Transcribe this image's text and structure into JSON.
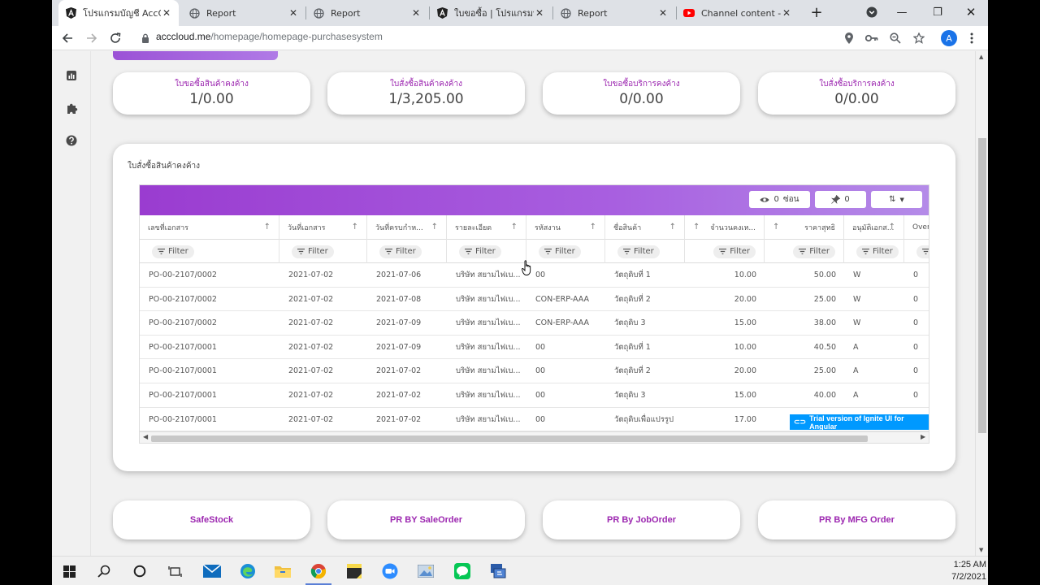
{
  "browser": {
    "tabs": [
      {
        "title": "โปรแกรมบัญชี AccClo",
        "icon": "angular-icon",
        "active": true
      },
      {
        "title": "Report",
        "icon": "globe-icon",
        "active": false
      },
      {
        "title": "Report",
        "icon": "globe-icon",
        "active": false
      },
      {
        "title": "ใบขอซื้อ | โปรแกรมบัญ",
        "icon": "angular-icon",
        "active": false
      },
      {
        "title": "Report",
        "icon": "globe-icon",
        "active": false
      },
      {
        "title": "Channel content - Y",
        "icon": "youtube-icon",
        "active": false
      }
    ],
    "url_host": "acccloud.me",
    "url_path": "/homepage/homepage-purchasesystem",
    "avatar_letter": "A"
  },
  "stats": [
    {
      "title": "ใบขอซื้อสินค้าคงค้าง",
      "value": "1/0.00"
    },
    {
      "title": "ใบสั่งซื้อสินค้าคงค้าง",
      "value": "1/3,205.00"
    },
    {
      "title": "ใบขอซื้อบริการคงค้าง",
      "value": "0/0.00"
    },
    {
      "title": "ใบสั่งซื้อบริการคงค้าง",
      "value": "0/0.00"
    }
  ],
  "grid": {
    "title": "ใบสั่งซื้อสินค้าคงค้าง",
    "toolbar": {
      "hide_count": "0",
      "hide_label": "ซ่อน",
      "pin_count": "0"
    },
    "filter_label": "Filter",
    "columns": [
      "เลขที่เอกสาร",
      "วันที่เอกสาร",
      "วันที่ครบกำห...",
      "รายละเอียด",
      "รหัสงาน",
      "ชื่อสินค้า",
      "จำนวนคงเห...",
      "ราคาสุทธิ",
      "อนุมัติเอกส...",
      "Over"
    ],
    "rows": [
      [
        "PO-00-2107/0002",
        "2021-07-02",
        "2021-07-06",
        "บริษัท สยามไฟเบ...",
        "00",
        "วัตถุดิบที่ 1",
        "10.00",
        "50.00",
        "W",
        "0"
      ],
      [
        "PO-00-2107/0002",
        "2021-07-02",
        "2021-07-08",
        "บริษัท สยามไฟเบ...",
        "CON-ERP-AAA",
        "วัตถุดิบที่ 2",
        "20.00",
        "25.00",
        "W",
        "0"
      ],
      [
        "PO-00-2107/0002",
        "2021-07-02",
        "2021-07-09",
        "บริษัท สยามไฟเบ...",
        "CON-ERP-AAA",
        "วัตถุดิบ 3",
        "15.00",
        "38.00",
        "W",
        "0"
      ],
      [
        "PO-00-2107/0001",
        "2021-07-02",
        "2021-07-09",
        "บริษัท สยามไฟเบ...",
        "00",
        "วัตถุดิบที่ 1",
        "10.00",
        "40.50",
        "A",
        "0"
      ],
      [
        "PO-00-2107/0001",
        "2021-07-02",
        "2021-07-02",
        "บริษัท สยามไฟเบ...",
        "00",
        "วัตถุดิบที่ 2",
        "20.00",
        "25.00",
        "A",
        "0"
      ],
      [
        "PO-00-2107/0001",
        "2021-07-02",
        "2021-07-02",
        "บริษัท สยามไฟเบ...",
        "00",
        "วัตถุดิบ 3",
        "15.00",
        "40.00",
        "A",
        "0"
      ],
      [
        "PO-00-2107/0001",
        "2021-07-02",
        "2021-07-02",
        "บริษัท สยามไฟเบ...",
        "00",
        "วัตถุดิบเพื่อแปรรูป",
        "17.00",
        "",
        "",
        ""
      ]
    ],
    "trial_notice": "Trial version of Ignite UI for Angular"
  },
  "links": [
    "SafeStock",
    "PR BY SaleOrder",
    "PR By JobOrder",
    "PR By MFG Order"
  ],
  "taskbar": {
    "time": "1:25 AM",
    "date": "7/2/2021"
  },
  "colors": {
    "accent": "#9c27b0",
    "header_start": "#9a3cd0",
    "header_end": "#b48be8",
    "trial": "#0099ff"
  }
}
